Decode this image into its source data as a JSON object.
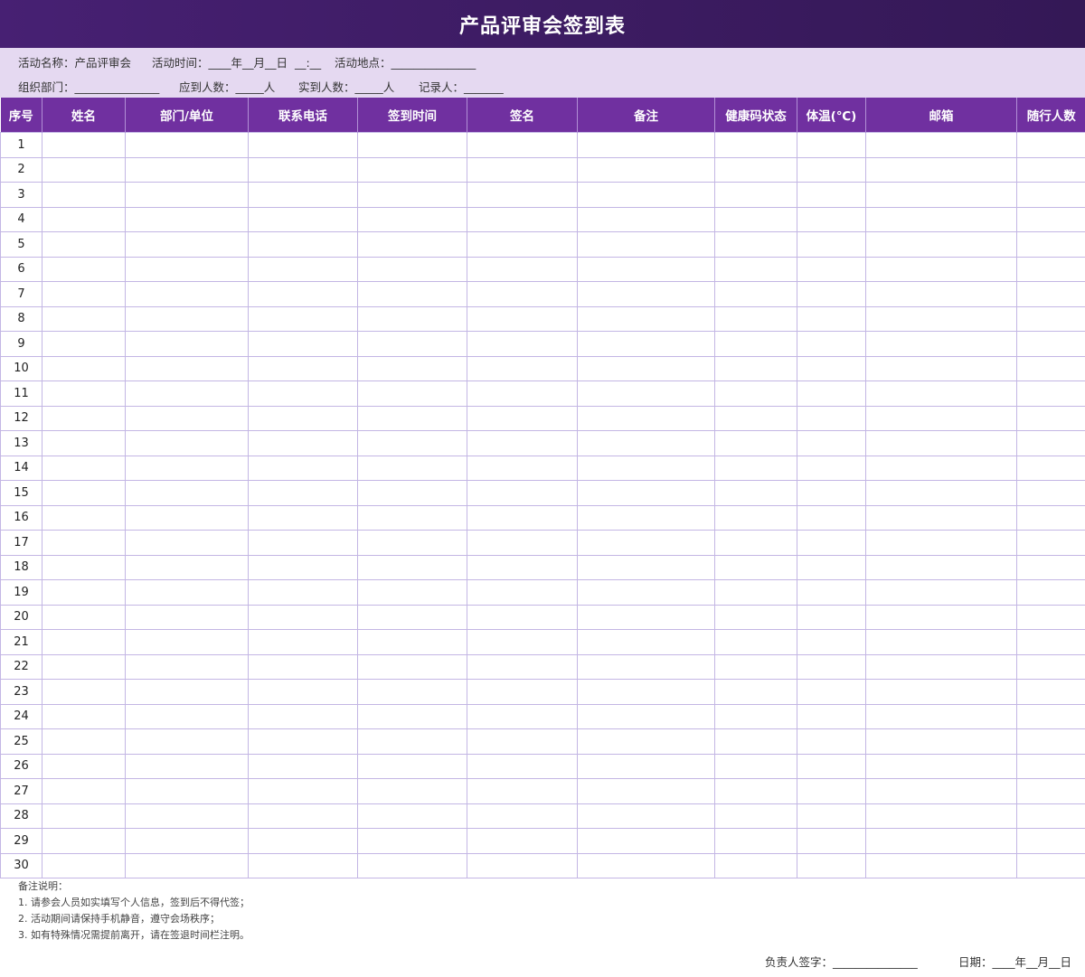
{
  "title": "产品评审会签到表",
  "info": {
    "row1": [
      "活动名称：产品评审会",
      "活动时间：____年__月__日  __:__",
      "活动地点：_______________"
    ],
    "row2": [
      "组织部门：_______________",
      "应到人数：_____人",
      "实到人数：_____人",
      "记录人：_______"
    ]
  },
  "table": {
    "headers": [
      "序号",
      "姓名",
      "部门/单位",
      "联系电话",
      "签到时间",
      "签名",
      "备注",
      "健康码状态",
      "体温(℃)",
      "邮箱",
      "随行人数"
    ],
    "row_numbers": [
      "1",
      "2",
      "3",
      "4",
      "5",
      "6",
      "7",
      "8",
      "9",
      "10",
      "11",
      "12",
      "13",
      "14",
      "15",
      "16",
      "17",
      "18",
      "19",
      "20",
      "21",
      "22",
      "23",
      "24",
      "25",
      "26",
      "27",
      "28",
      "29",
      "30"
    ]
  },
  "notes": {
    "heading": "备注说明：",
    "items": [
      "1. 请参会人员如实填写个人信息，签到后不得代签；",
      "2. 活动期间请保持手机静音，遵守会场秩序；",
      "3. 如有特殊情况需提前离开，请在签退时间栏注明。"
    ]
  },
  "footer": {
    "signer": "负责人签字：_______________",
    "date": "日期：____年__月__日"
  },
  "colors": {
    "title_bg": "#3d1c63",
    "info_bg": "#e5d9f1",
    "header_bg": "#7030a0",
    "grid_line": "#c3b6e4"
  }
}
